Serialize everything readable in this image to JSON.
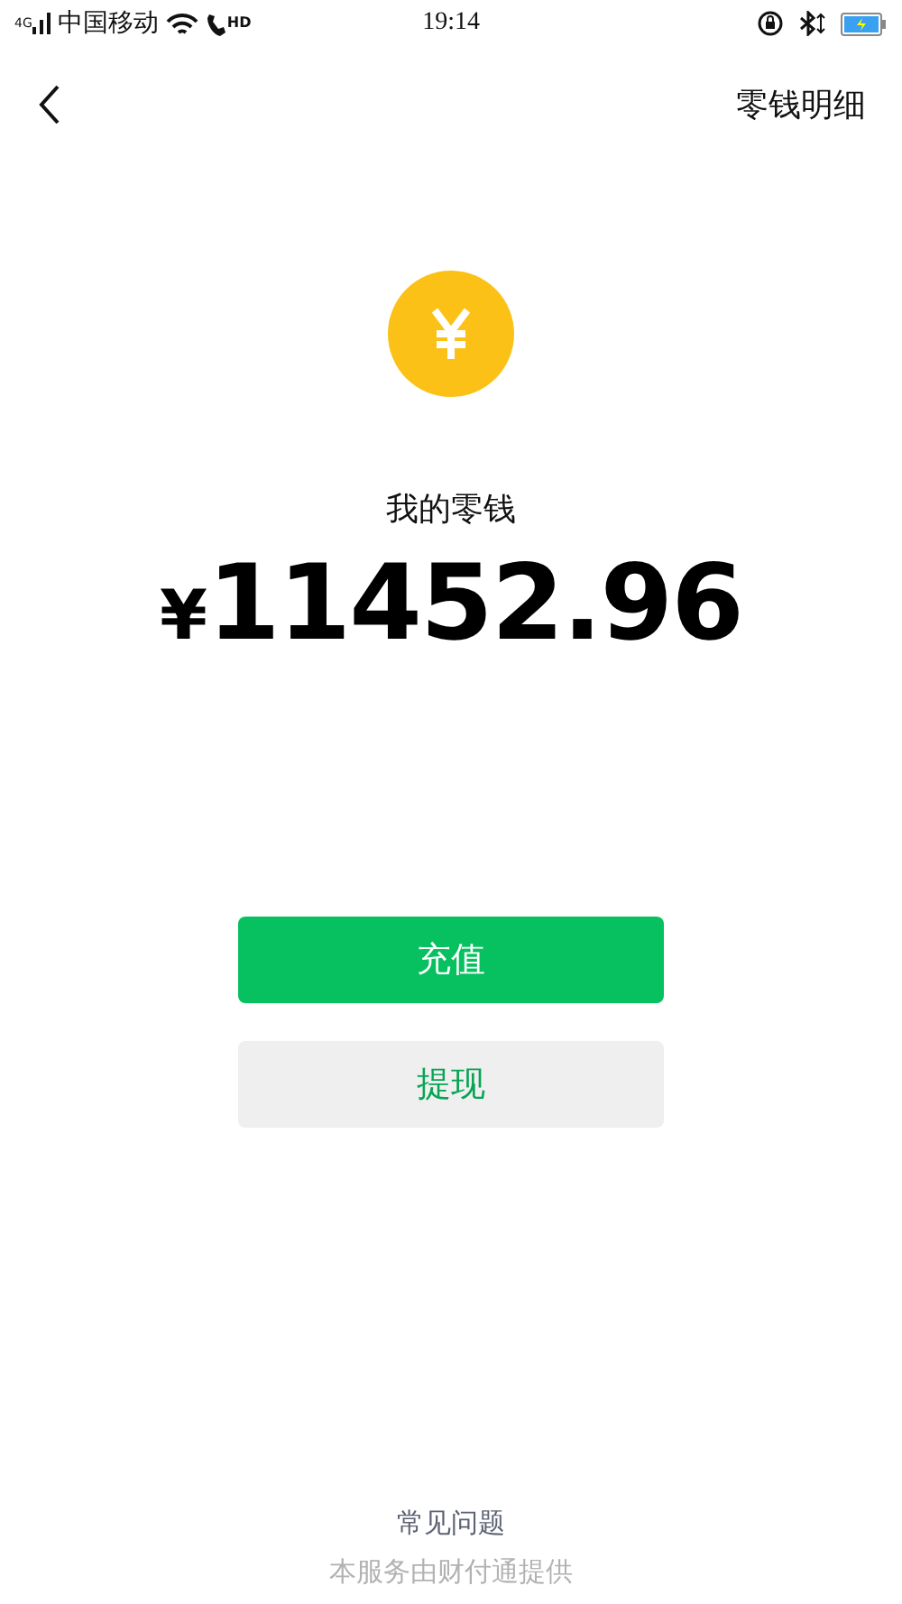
{
  "status_bar": {
    "network": "4G",
    "carrier": "中国移动",
    "call_badge": "HD",
    "time": "19:14"
  },
  "nav": {
    "title": "零钱明细"
  },
  "balance": {
    "label": "我的零钱",
    "currency": "¥",
    "amount": "11452.96"
  },
  "buttons": [
    {
      "label": "充值",
      "kind": "primary"
    },
    {
      "label": "提现",
      "kind": "secondary"
    }
  ],
  "footer": {
    "link": "常见问题",
    "note": "本服务由财付通提供"
  }
}
